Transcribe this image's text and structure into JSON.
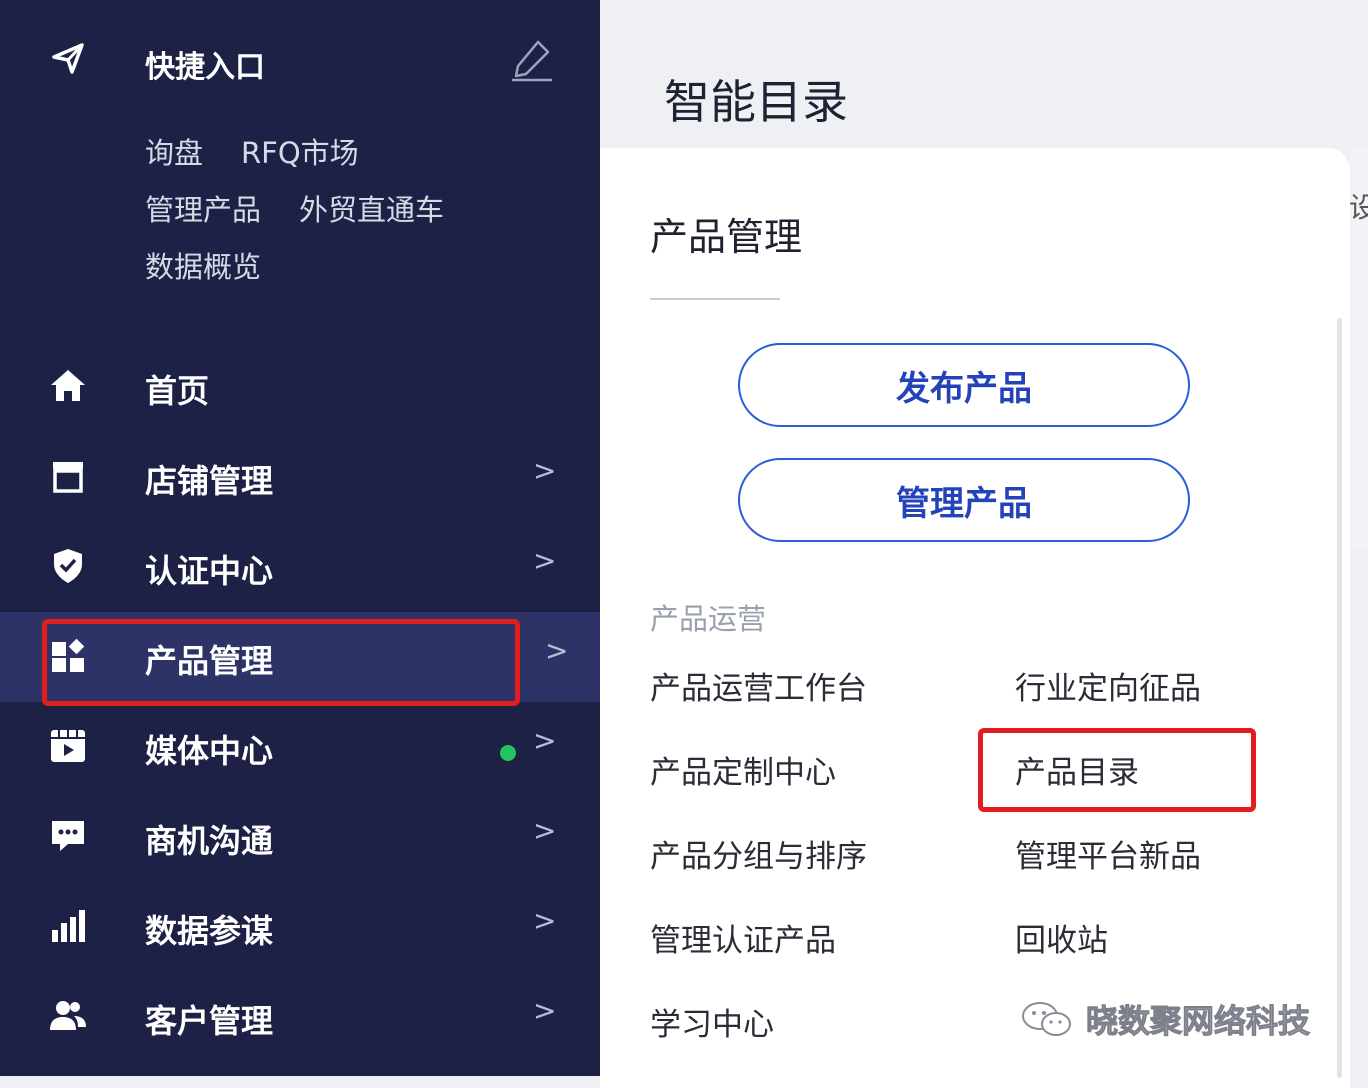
{
  "quick_access": {
    "title": "快捷入口",
    "links": [
      "询盘",
      "RFQ市场",
      "管理产品",
      "外贸直通车",
      "数据概览"
    ]
  },
  "nav": {
    "items": [
      {
        "label": "首页",
        "icon": "home-icon",
        "chevron": ""
      },
      {
        "label": "店铺管理",
        "icon": "store-icon",
        "chevron": ">"
      },
      {
        "label": "认证中心",
        "icon": "shield-icon",
        "chevron": ">"
      },
      {
        "label": "产品管理",
        "icon": "grid-icon",
        "chevron": ">",
        "active": true
      },
      {
        "label": "媒体中心",
        "icon": "media-icon",
        "chevron": ">",
        "status_dot": true
      },
      {
        "label": "商机沟通",
        "icon": "chat-icon",
        "chevron": ">"
      },
      {
        "label": "数据参谋",
        "icon": "bar-chart-icon",
        "chevron": ">"
      },
      {
        "label": "客户管理",
        "icon": "users-icon",
        "chevron": ">"
      }
    ]
  },
  "page": {
    "title": "智能目录"
  },
  "panel": {
    "title": "产品管理",
    "buttons": [
      "发布产品",
      "管理产品"
    ],
    "section_label": "产品运营",
    "links": [
      "产品运营工作台",
      "行业定向征品",
      "产品定制中心",
      "产品目录",
      "产品分组与排序",
      "管理平台新品",
      "管理认证产品",
      "回收站",
      "学习中心"
    ]
  },
  "edge_char": "设",
  "watermark": {
    "text": "晓数聚网络科技",
    "icon": "wechat-icon"
  },
  "colors": {
    "sidebar_bg": "#1d2145",
    "sidebar_active": "#2d3366",
    "accent_blue": "#2b5fd9",
    "highlight_red": "#e11d1d",
    "status_green": "#22c55e"
  }
}
